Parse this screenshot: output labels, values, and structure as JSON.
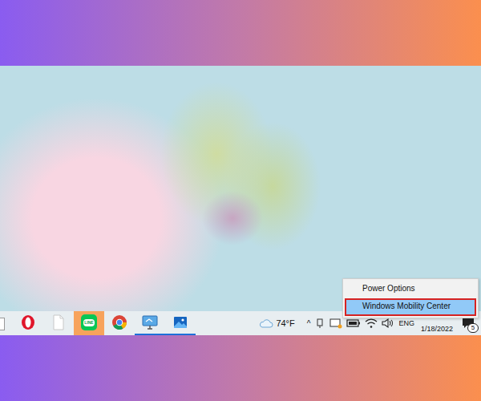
{
  "taskbar": {
    "apps": [
      {
        "kind": "opera",
        "label": "",
        "selected": false,
        "running": false
      },
      {
        "kind": "file",
        "label": "",
        "selected": false,
        "running": false
      },
      {
        "kind": "line",
        "label": "LINE",
        "selected": true,
        "running": false
      },
      {
        "kind": "chrome",
        "label": "",
        "selected": false,
        "running": false
      },
      {
        "kind": "monitor",
        "label": "",
        "selected": false,
        "running": true
      },
      {
        "kind": "photos",
        "label": "",
        "selected": false,
        "running": true
      }
    ]
  },
  "tray": {
    "temperature": "74°F",
    "chevron": "^",
    "language": "ENG",
    "date": "1/18/2022",
    "notifications": "5"
  },
  "context_menu": {
    "items": [
      {
        "label": "Power Options",
        "selected": false
      },
      {
        "label": "Windows Mobility Center",
        "selected": true
      }
    ]
  }
}
